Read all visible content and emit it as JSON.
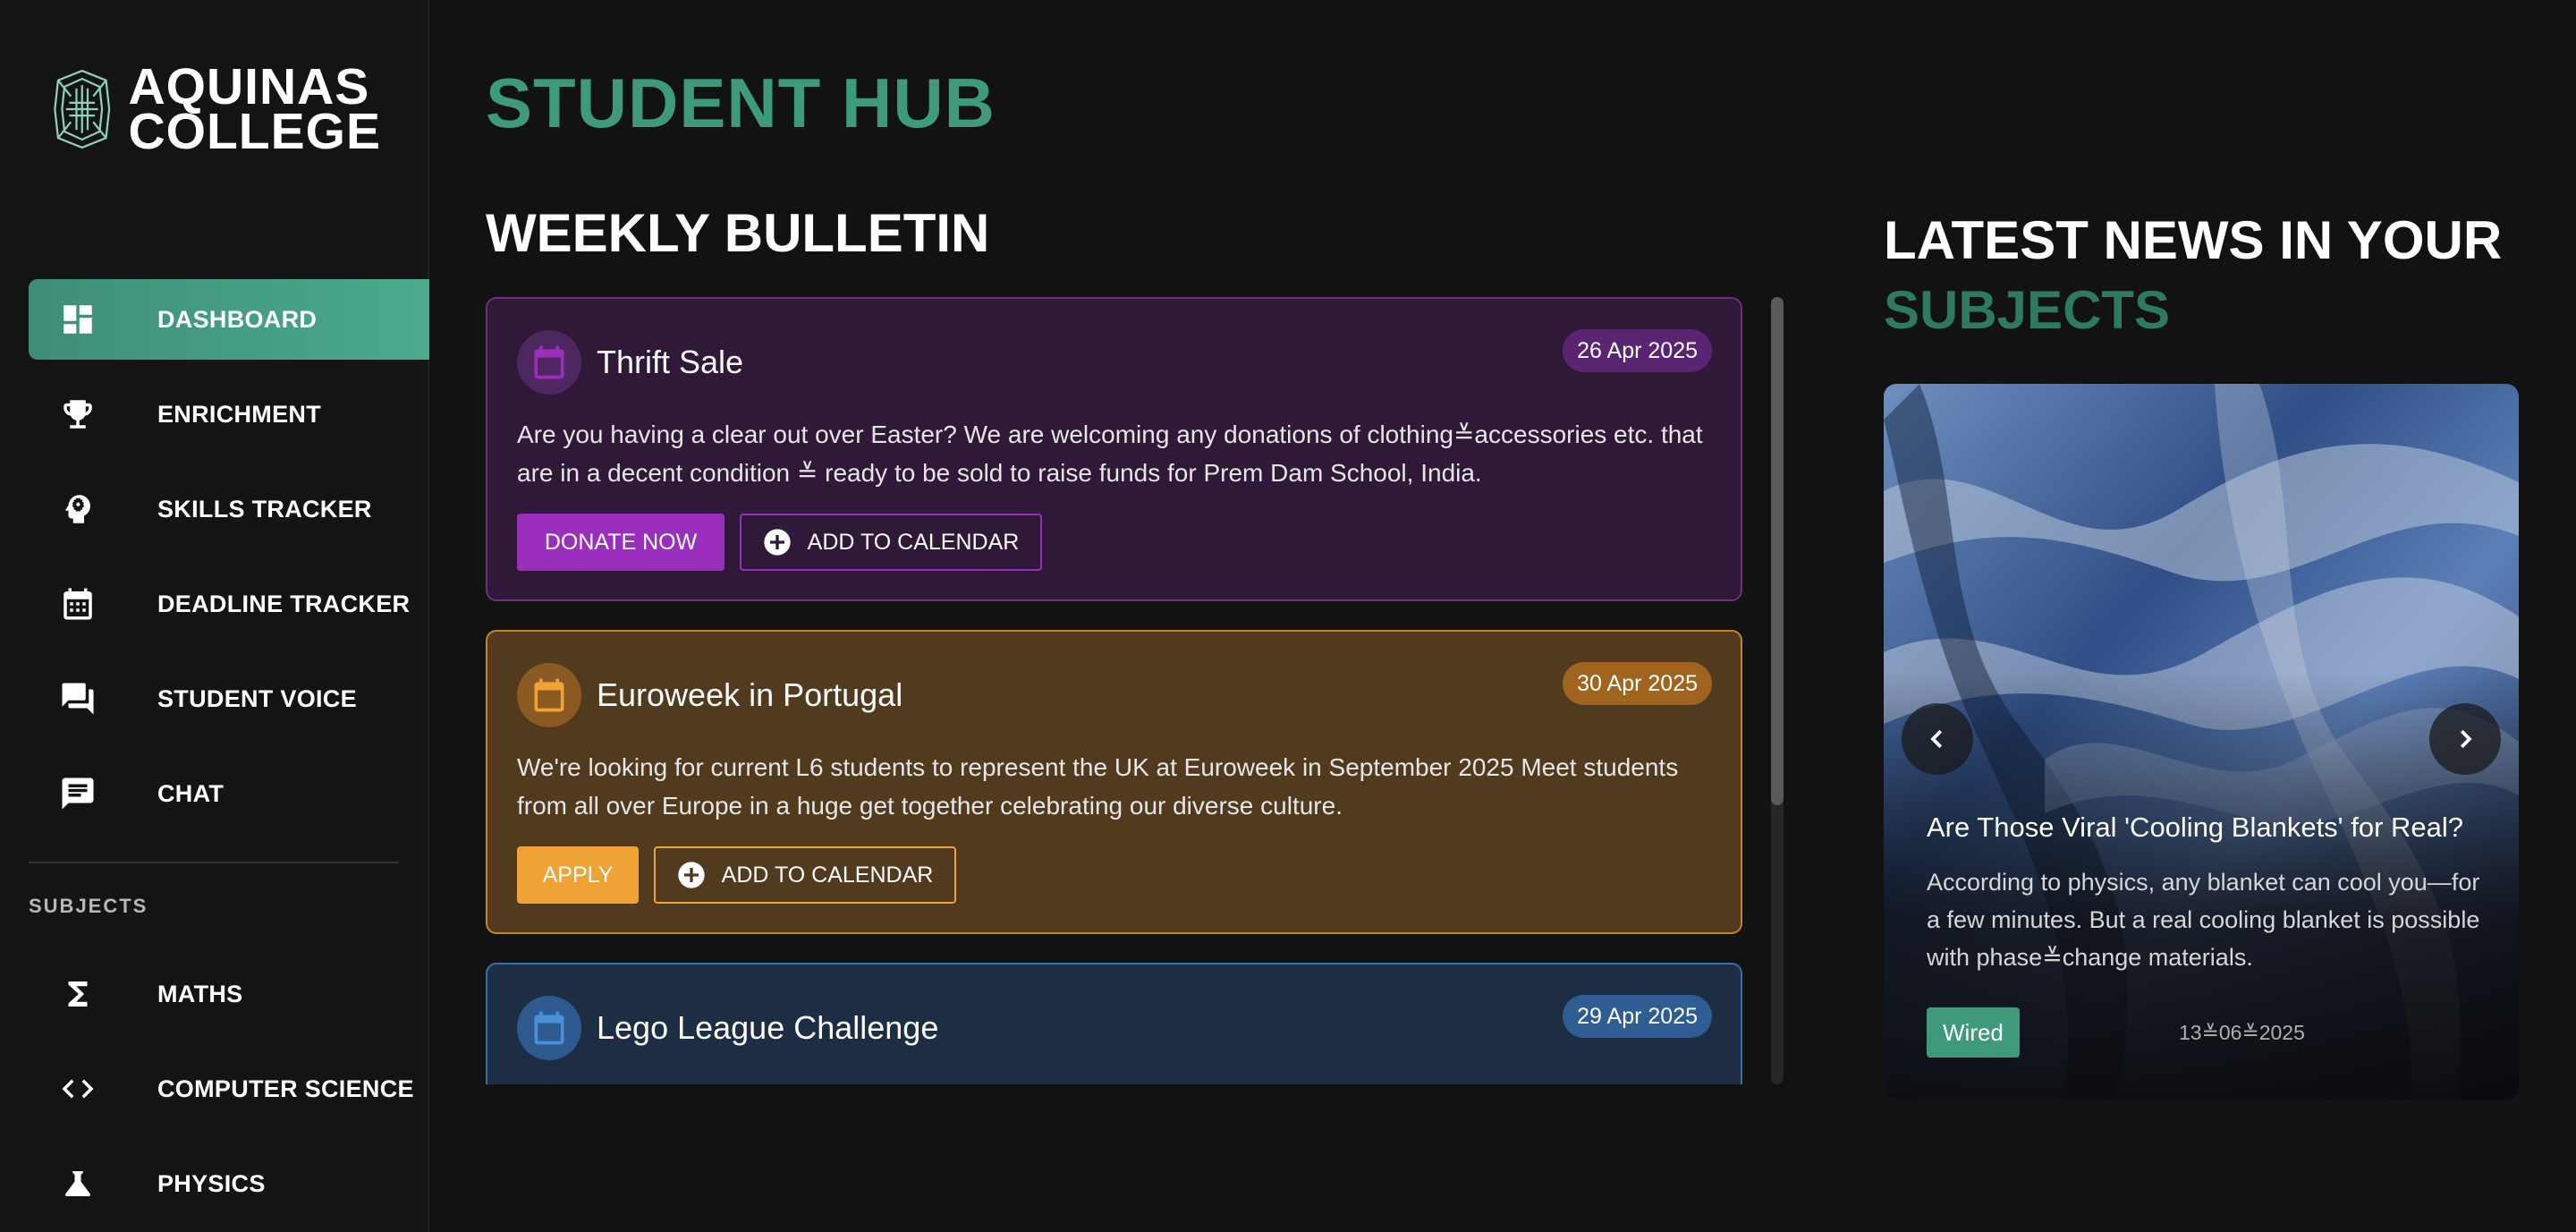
{
  "brand": {
    "line1": "AQUINAS",
    "line2": "COLLEGE"
  },
  "nav": {
    "items": [
      {
        "label": "DASHBOARD",
        "icon": "dashboard-icon",
        "active": true
      },
      {
        "label": "ENRICHMENT",
        "icon": "trophy-icon"
      },
      {
        "label": "SKILLS TRACKER",
        "icon": "brain-gear-icon"
      },
      {
        "label": "DEADLINE TRACKER",
        "icon": "calendar-icon"
      },
      {
        "label": "STUDENT VOICE",
        "icon": "forum-icon"
      },
      {
        "label": "CHAT",
        "icon": "chat-icon"
      }
    ],
    "subjects_heading": "SUBJECTS",
    "subjects": [
      {
        "label": "MATHS",
        "icon": "sigma-icon"
      },
      {
        "label": "COMPUTER SCIENCE",
        "icon": "code-icon"
      },
      {
        "label": "PHYSICS",
        "icon": "flask-icon"
      }
    ]
  },
  "page_title": "STUDENT HUB",
  "bulletin": {
    "title": "WEEKLY BULLETIN",
    "cards": [
      {
        "title": "Thrift Sale",
        "date": "26 Apr 2025",
        "text": "Are you having a clear out over Easter? We are welcoming any donations of clothing≚accessories etc. that are in a decent condition ≚ ready to be sold to raise funds for Prem Dam School, India.",
        "primary_label": "DONATE NOW",
        "secondary_label": "ADD TO CALENDAR",
        "color": "#9a2fbd"
      },
      {
        "title": "Euroweek in Portugal",
        "date": "30 Apr 2025",
        "text": "We're looking for current L6 students to represent the UK at Euroweek in September 2025 Meet students from all over Europe in a huge get together celebrating our diverse culture.",
        "primary_label": "APPLY",
        "secondary_label": "ADD TO CALENDAR",
        "color": "#f0a234"
      },
      {
        "title": "Lego League Challenge",
        "date": "29 Apr 2025",
        "color": "#3a6ea6"
      }
    ]
  },
  "news": {
    "title_line1": "LATEST NEWS IN YOUR",
    "title_line2": "SUBJECTS",
    "headline": "Are Those Viral 'Cooling Blankets' for Real?",
    "body": "According to physics, any blanket can cool you—for a few minutes. But a real cooling blanket is possible with phase≚change materials.",
    "source": "Wired",
    "date": "13≚06≚2025"
  },
  "colors": {
    "accent": "#3e9a7c",
    "background": "#121212",
    "sidebar": "#141414"
  }
}
